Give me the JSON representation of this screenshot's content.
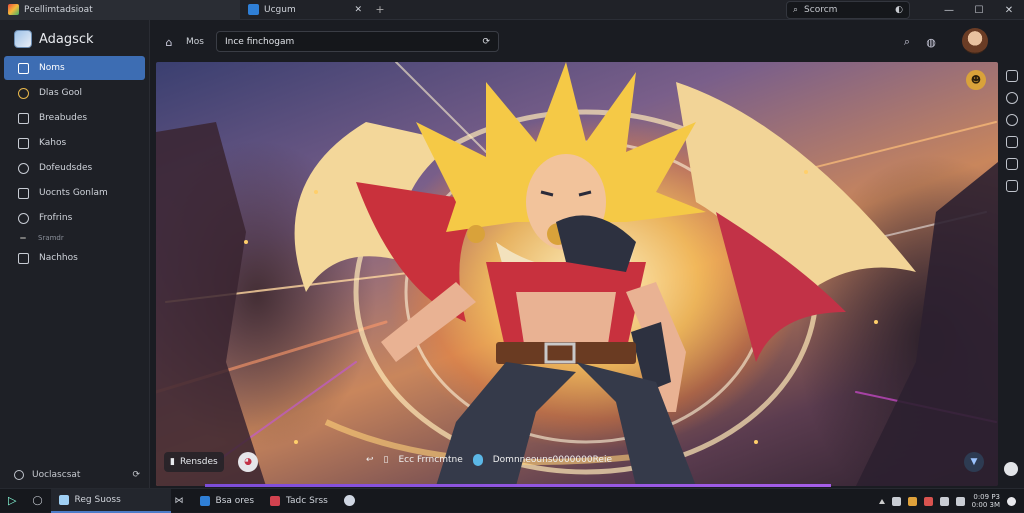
{
  "titlebar": {
    "tabs": [
      {
        "label": "Pcellimtadsioat"
      },
      {
        "label": "Ucgum"
      }
    ],
    "new_tab": "+",
    "close": "✕",
    "search_placeholder": "Scorcm",
    "controls": {
      "minimize": "—",
      "maximize": "☐",
      "close": "✕"
    }
  },
  "sidebar": {
    "brand": "Adagsck",
    "items": [
      {
        "label": "Noms",
        "active": true
      },
      {
        "label": "Dlas Gool"
      },
      {
        "label": "Breabudes"
      },
      {
        "label": "Kahos"
      },
      {
        "label": "Dofeudsdes"
      },
      {
        "label": "Uocnts Gonlam"
      },
      {
        "label": "Frofrins"
      },
      {
        "label": "Sramdr"
      },
      {
        "label": "Nachhos"
      }
    ],
    "footer": "Uoclascsat"
  },
  "topbar": {
    "label": "Mos",
    "url": "Ince finchogam"
  },
  "viewer": {
    "left_control": "Rensdes",
    "center_items": [
      "Ecc Frrncmtne",
      "Domnneouns0000000Reie"
    ],
    "colors": {
      "accent": "#7c4dd8",
      "active_nav": "#3d6db3",
      "badge": "#d9a23a"
    }
  },
  "taskbar": {
    "apps": [
      {
        "label": "Reg Suoss"
      },
      {
        "label": "Bsa ores"
      },
      {
        "label": "Tadc Srss"
      }
    ],
    "clock": {
      "time": "0:09 P3",
      "date": "0:00 3M"
    }
  }
}
